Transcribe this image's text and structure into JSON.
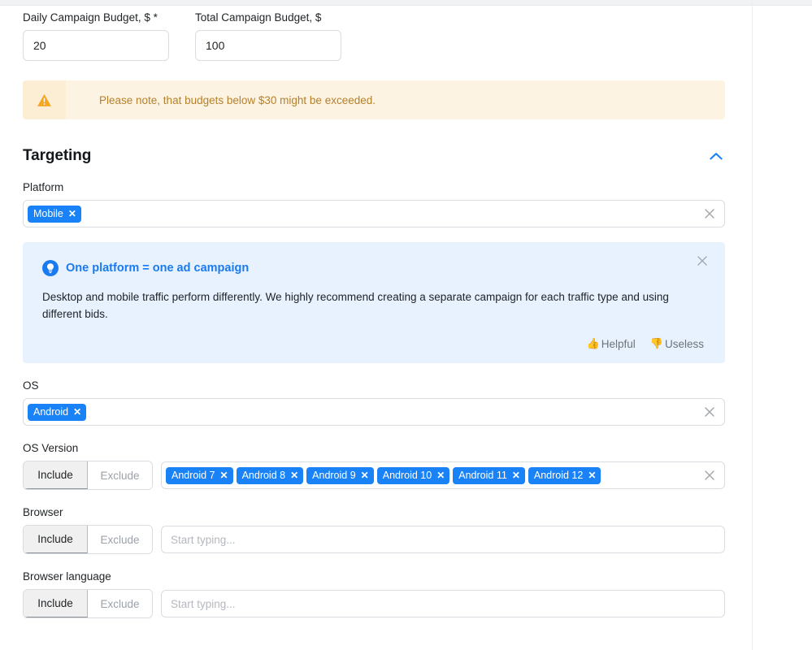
{
  "budget": {
    "daily": {
      "label": "Daily Campaign Budget, $ *",
      "value": "20",
      "placeholder": ""
    },
    "total": {
      "label": "Total Campaign Budget, $",
      "value": "100",
      "placeholder": ""
    }
  },
  "warning": {
    "icon": "warning-triangle-icon",
    "text": "Please note, that budgets below $30 might be exceeded."
  },
  "targeting": {
    "title": "Targeting",
    "collapse_icon": "chevron-up-icon",
    "accent_color": "#1a82f7",
    "platform": {
      "label": "Platform",
      "chips": [
        "Mobile"
      ],
      "clear_icon": "close-icon"
    },
    "info": {
      "icon": "lightbulb-icon",
      "title": "One platform = one ad campaign",
      "body": "Desktop and mobile traffic perform differently. We highly recommend creating a separate campaign for each traffic type and using different bids.",
      "close_icon": "close-icon",
      "helpful_label": "Helpful",
      "helpful_icon": "thumbs-up-icon",
      "useless_label": "Useless",
      "useless_icon": "thumbs-down-icon",
      "background_color": "#e8f2fe"
    },
    "os": {
      "label": "OS",
      "chips": [
        "Android"
      ],
      "clear_icon": "close-icon"
    },
    "os_version": {
      "label": "OS Version",
      "include_label": "Include",
      "exclude_label": "Exclude",
      "selected_mode": "Include",
      "chips": [
        "Android 7",
        "Android 8",
        "Android 9",
        "Android 10",
        "Android 11",
        "Android 12"
      ],
      "clear_icon": "close-icon"
    },
    "browser": {
      "label": "Browser",
      "include_label": "Include",
      "exclude_label": "Exclude",
      "selected_mode": "Include",
      "placeholder": "Start typing...",
      "value": ""
    },
    "browser_language": {
      "label": "Browser language",
      "include_label": "Include",
      "exclude_label": "Exclude",
      "selected_mode": "Include",
      "placeholder": "Start typing...",
      "value": ""
    }
  }
}
